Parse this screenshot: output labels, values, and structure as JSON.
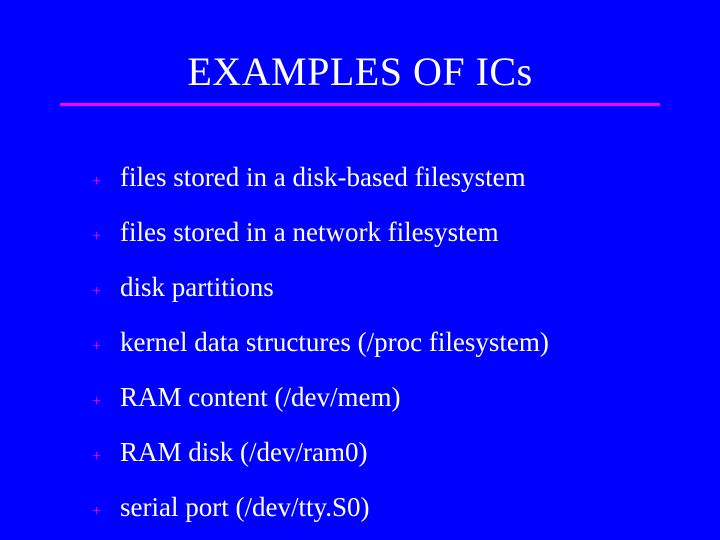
{
  "title": "EXAMPLES OF ICs",
  "bullet_glyph": "+",
  "items": [
    "files stored in a disk-based filesystem",
    "files stored in a network filesystem",
    "disk partitions",
    "kernel data structures (/proc filesystem)",
    "RAM content (/dev/mem)",
    "RAM disk (/dev/ram0)",
    "serial port (/dev/tty.S0)"
  ]
}
